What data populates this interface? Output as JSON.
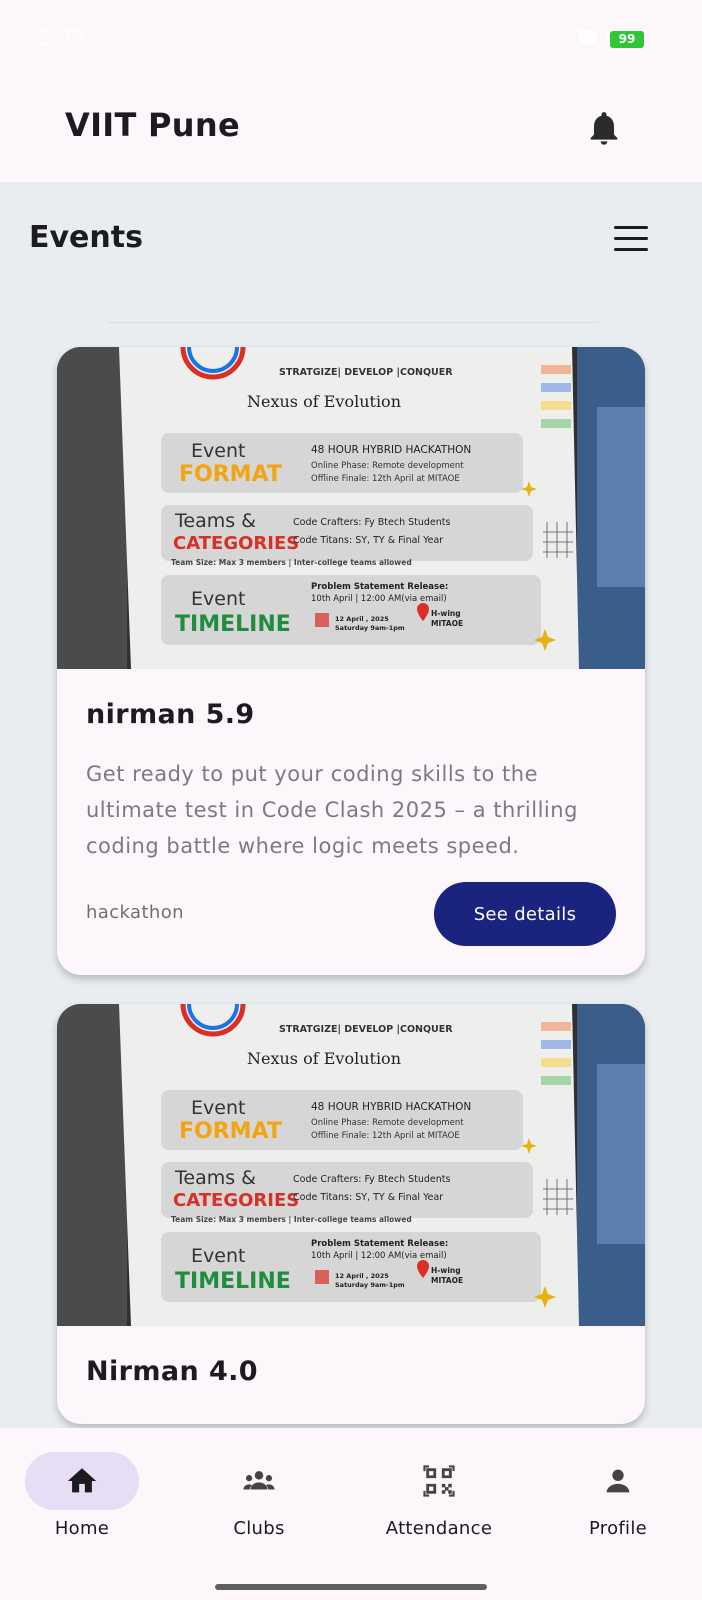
{
  "app": {
    "title": "VIIT Pune"
  },
  "status_bar": {
    "time": "5:37",
    "battery": "99"
  },
  "section": {
    "title": "Events"
  },
  "events": [
    {
      "title": "nirman 5.9",
      "description": "Get ready to put your coding skills to the ultimate test in Code Clash 2025 – a thrilling coding battle where logic meets speed. Compe…",
      "tag": "hackathon",
      "button_label": "See details",
      "poster": {
        "header": "STRATGIZE| DEVELOP |CONQUER",
        "subtitle": "Nexus of Evolution",
        "format_title": "Event",
        "format_sub": "FORMAT",
        "format_line1": "48 HOUR HYBRID HACKATHON",
        "format_line2": "Online Phase: Remote development",
        "format_line3": "Offline Finale: 12th April at MITAOE",
        "teams_title": "Teams &",
        "teams_sub": "CATEGORIES",
        "teams_line1": "Code Crafters: Fy Btech Students",
        "teams_line2": "Code Titans: SY, TY & Final Year",
        "teams_size": "Team Size: Max 3 members | Inter-college teams allowed",
        "timeline_title": "Event",
        "timeline_sub": "TIMELINE",
        "timeline_line1": "Problem Statement Release:",
        "timeline_line2": "10th April | 12:00 AM(via email)",
        "timeline_date": "12 April , 2025",
        "timeline_time": "Saturday 9am-1pm",
        "timeline_place1": "H-wing",
        "timeline_place2": "MITAOE"
      }
    },
    {
      "title": "Nirman 4.0",
      "poster": {
        "header": "STRATGIZE| DEVELOP |CONQUER",
        "subtitle": "Nexus of Evolution",
        "format_title": "Event",
        "format_sub": "FORMAT",
        "format_line1": "48 HOUR HYBRID HACKATHON",
        "format_line2": "Online Phase: Remote development",
        "format_line3": "Offline Finale: 12th April at MITAOE",
        "teams_title": "Teams &",
        "teams_sub": "CATEGORIES",
        "teams_line1": "Code Crafters: Fy Btech Students",
        "teams_line2": "Code Titans: SY, TY & Final Year",
        "teams_size": "Team Size: Max 3 members | Inter-college teams allowed",
        "timeline_title": "Event",
        "timeline_sub": "TIMELINE",
        "timeline_line1": "Problem Statement Release:",
        "timeline_line2": "10th April | 12:00 AM(via email)",
        "timeline_date": "12 April , 2025",
        "timeline_time": "Saturday 9am-1pm",
        "timeline_place1": "H-wing",
        "timeline_place2": "MITAOE"
      }
    }
  ],
  "bottom_nav": [
    {
      "label": "Home",
      "icon": "home-icon",
      "active": true
    },
    {
      "label": "Clubs",
      "icon": "groups-icon",
      "active": false
    },
    {
      "label": "Attendance",
      "icon": "qr-code-icon",
      "active": false
    },
    {
      "label": "Profile",
      "icon": "person-icon",
      "active": false
    }
  ],
  "colors": {
    "primary_button": "#1a237e",
    "surface": "#fdf6fb",
    "background": "#e9edf0",
    "nav_active_pill": "#e7ddf5"
  }
}
